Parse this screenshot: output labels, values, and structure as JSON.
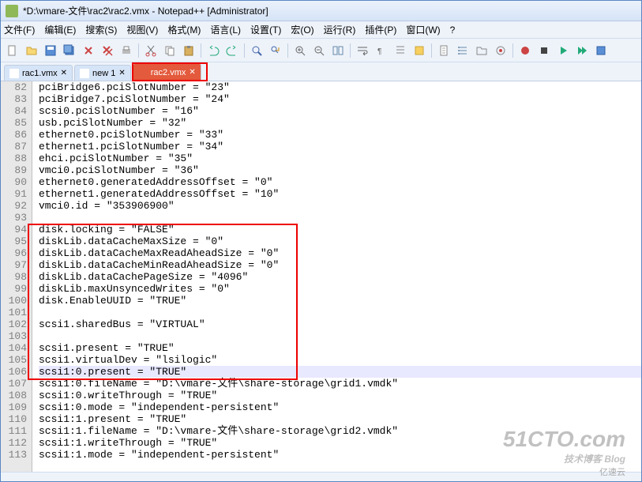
{
  "title": "*D:\\vmare-文件\\rac2\\rac2.vmx - Notepad++ [Administrator]",
  "menu": {
    "file": "文件(F)",
    "edit": "编辑(E)",
    "search": "搜索(S)",
    "view": "视图(V)",
    "format": "格式(M)",
    "language": "语言(L)",
    "settings": "设置(T)",
    "macro": "宏(O)",
    "run": "运行(R)",
    "plugins": "插件(P)",
    "window": "窗口(W)",
    "help": "?"
  },
  "tabs": [
    {
      "label": "rac1.vmx",
      "active": false
    },
    {
      "label": "new 1",
      "active": false
    },
    {
      "label": "rac2.vmx",
      "active": true
    }
  ],
  "lines": [
    {
      "n": 82,
      "t": "pciBridge6.pciSlotNumber = \"23\""
    },
    {
      "n": 83,
      "t": "pciBridge7.pciSlotNumber = \"24\""
    },
    {
      "n": 84,
      "t": "scsi0.pciSlotNumber = \"16\""
    },
    {
      "n": 85,
      "t": "usb.pciSlotNumber = \"32\""
    },
    {
      "n": 86,
      "t": "ethernet0.pciSlotNumber = \"33\""
    },
    {
      "n": 87,
      "t": "ethernet1.pciSlotNumber = \"34\""
    },
    {
      "n": 88,
      "t": "ehci.pciSlotNumber = \"35\""
    },
    {
      "n": 89,
      "t": "vmci0.pciSlotNumber = \"36\""
    },
    {
      "n": 90,
      "t": "ethernet0.generatedAddressOffset = \"0\""
    },
    {
      "n": 91,
      "t": "ethernet1.generatedAddressOffset = \"10\""
    },
    {
      "n": 92,
      "t": "vmci0.id = \"353906900\""
    },
    {
      "n": 93,
      "t": ""
    },
    {
      "n": 94,
      "t": "disk.locking = \"FALSE\""
    },
    {
      "n": 95,
      "t": "diskLib.dataCacheMaxSize = \"0\""
    },
    {
      "n": 96,
      "t": "diskLib.dataCacheMaxReadAheadSize = \"0\""
    },
    {
      "n": 97,
      "t": "diskLib.dataCacheMinReadAheadSize = \"0\""
    },
    {
      "n": 98,
      "t": "diskLib.dataCachePageSize = \"4096\""
    },
    {
      "n": 99,
      "t": "diskLib.maxUnsyncedWrites = \"0\""
    },
    {
      "n": 100,
      "t": "disk.EnableUUID = \"TRUE\""
    },
    {
      "n": 101,
      "t": ""
    },
    {
      "n": 102,
      "t": "scsi1.sharedBus = \"VIRTUAL\""
    },
    {
      "n": 103,
      "t": ""
    },
    {
      "n": 104,
      "t": "scsi1.present = \"TRUE\""
    },
    {
      "n": 105,
      "t": "scsi1.virtualDev = \"lsilogic\""
    },
    {
      "n": 106,
      "t": "scsi1:0.present = \"TRUE\"",
      "current": true
    },
    {
      "n": 107,
      "t": "scsi1:0.fileName = \"D:\\vmare-文件\\share-storage\\grid1.vmdk\""
    },
    {
      "n": 108,
      "t": "scsi1:0.writeThrough = \"TRUE\""
    },
    {
      "n": 109,
      "t": "scsi1:0.mode = \"independent-persistent\""
    },
    {
      "n": 110,
      "t": "scsi1:1.present = \"TRUE\""
    },
    {
      "n": 111,
      "t": "scsi1:1.fileName = \"D:\\vmare-文件\\share-storage\\grid2.vmdk\""
    },
    {
      "n": 112,
      "t": "scsi1:1.writeThrough = \"TRUE\""
    },
    {
      "n": 113,
      "t": "scsi1:1.mode = \"independent-persistent\""
    }
  ],
  "tab_close": "✕",
  "watermark": {
    "main": "51CTO.com",
    "sub": "技术博客 Blog"
  },
  "cloud": "亿速云"
}
